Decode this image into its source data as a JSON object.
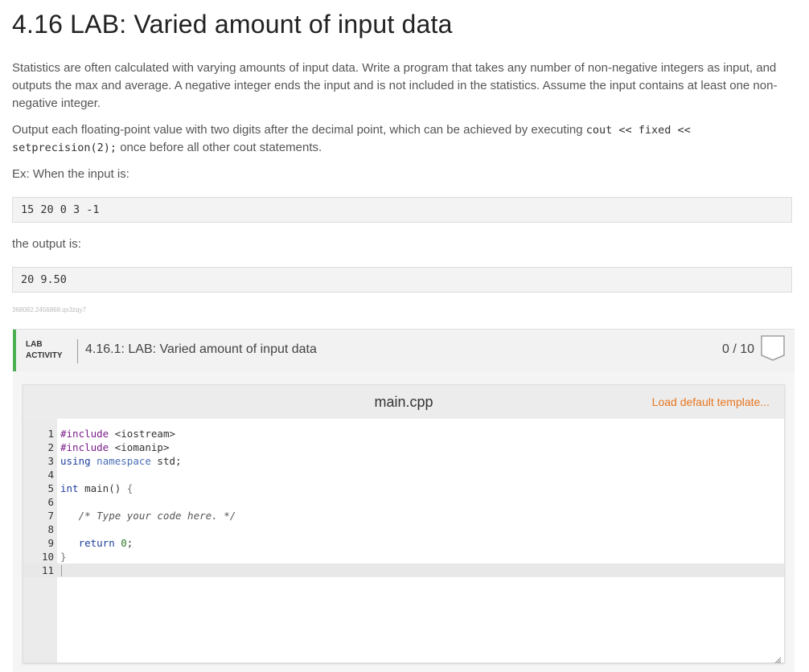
{
  "title": "4.16 LAB: Varied amount of input data",
  "description": "Statistics are often calculated with varying amounts of input data. Write a program that takes any number of non-negative integers as input, and outputs the max and average. A negative integer ends the input and is not included in the statistics. Assume the input contains at least one non-negative integer.",
  "output_note": {
    "prefix": "Output each floating-point value with two digits after the decimal point, which can be achieved by executing ",
    "code1": "cout << fixed <<",
    "code2": "setprecision(2);",
    "suffix": " once before all other cout statements."
  },
  "example_intro": "Ex: When the input is:",
  "example_input": "15 20 0 3 -1",
  "output_intro": "the output is:",
  "example_output": "20 9.50",
  "tracking_id": "368082.2456868.qx3zqy7",
  "lab": {
    "tag_line1": "LAB",
    "tag_line2": "ACTIVITY",
    "title": "4.16.1: LAB: Varied amount of input data",
    "score": "0 / 10",
    "accent_color": "#4caf50"
  },
  "editor": {
    "filename": "main.cpp",
    "load_template": "Load default template...",
    "link_color": "#e8761f",
    "line_numbers": [
      "1",
      "2",
      "3",
      "4",
      "5",
      "6",
      "7",
      "8",
      "9",
      "10",
      "11"
    ],
    "code": {
      "l1a": "#include",
      "l1b": " <iostream>",
      "l2a": "#include",
      "l2b": " <iomanip>",
      "l3a": "using",
      "l3b": " namespace",
      "l3c": " std;",
      "l5a": "int",
      "l5b": " main() ",
      "l5c": "{",
      "l7": "   /* Type your code here. */",
      "l9a": "   return ",
      "l9b": "0",
      "l9c": ";",
      "l10": "}"
    }
  }
}
